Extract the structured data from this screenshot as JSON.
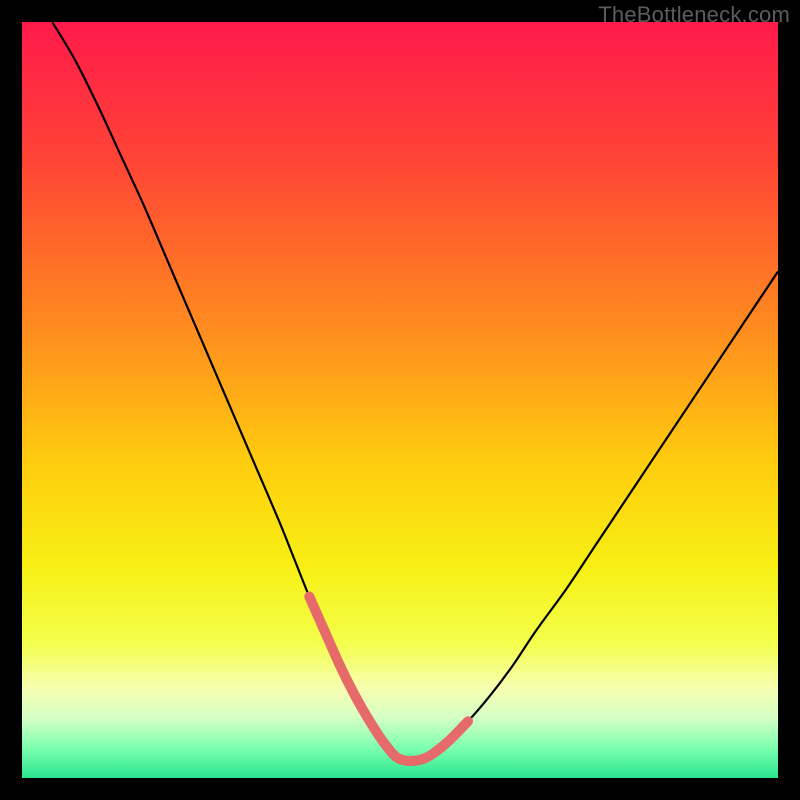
{
  "watermark": "TheBottleneck.com",
  "chart_data": {
    "type": "line",
    "title": "",
    "xlabel": "",
    "ylabel": "",
    "xlim": [
      0,
      100
    ],
    "ylim": [
      0,
      100
    ],
    "grid": false,
    "legend": false,
    "background_gradient_stops": [
      {
        "offset": 0.0,
        "color": "#ff1a4b"
      },
      {
        "offset": 0.18,
        "color": "#ff4336"
      },
      {
        "offset": 0.4,
        "color": "#ff8a1f"
      },
      {
        "offset": 0.58,
        "color": "#ffcc0f"
      },
      {
        "offset": 0.72,
        "color": "#f7ef14"
      },
      {
        "offset": 0.82,
        "color": "#f3ff4a"
      },
      {
        "offset": 0.88,
        "color": "#f7ffb0"
      },
      {
        "offset": 0.92,
        "color": "#d6ffc4"
      },
      {
        "offset": 0.96,
        "color": "#7dffb0"
      },
      {
        "offset": 1.0,
        "color": "#28e58d"
      }
    ],
    "series": [
      {
        "name": "bottleneck-curve",
        "color": "#000000",
        "width": 2.2,
        "x": [
          4,
          7,
          10,
          13,
          16,
          19,
          22,
          25,
          28,
          31,
          34,
          36,
          38,
          40,
          42,
          44,
          46,
          48,
          50,
          53,
          56,
          59,
          62,
          65,
          68,
          72,
          76,
          80,
          84,
          88,
          92,
          96,
          100
        ],
        "y": [
          100,
          95,
          89,
          82.5,
          76,
          69,
          62,
          55,
          48,
          41,
          34,
          29,
          24,
          19.5,
          15,
          11,
          7.5,
          4.5,
          2.5,
          2.5,
          4.5,
          7.5,
          11,
          15,
          19.5,
          25,
          31,
          37,
          43,
          49,
          55,
          61,
          67
        ]
      },
      {
        "name": "min-highlight",
        "color": "#e76a6a",
        "width": 10,
        "linecap": "round",
        "x": [
          38,
          40,
          42,
          44,
          46,
          48,
          50,
          53,
          56,
          59
        ],
        "y": [
          24,
          19.5,
          15,
          11,
          7.5,
          4.5,
          2.5,
          2.5,
          4.5,
          7.5
        ]
      }
    ]
  }
}
